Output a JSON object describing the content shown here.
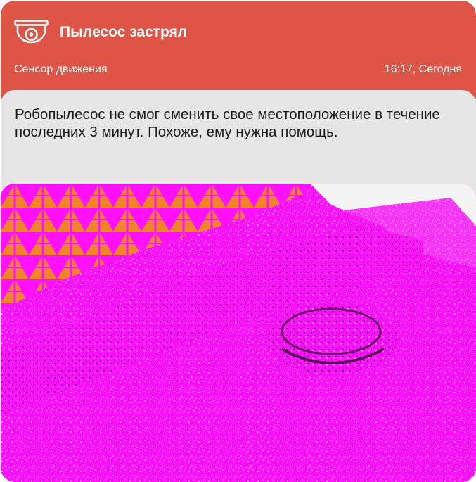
{
  "notification": {
    "title": "Пылесос застрял",
    "sensor": "Сенсор движения",
    "time": "16:17, Сегодня",
    "message": "Робопылесос не смог сменить свое местоположение в течение последних 3 минут. Похоже, ему нужна помощь.",
    "icon": "security-camera-icon"
  },
  "colors": {
    "header_bg": "#de5446",
    "body_bg": "#e6e6e6",
    "text_primary": "#1a1a1a",
    "header_text": "#ffffff"
  },
  "snapshot": {
    "description_visible": false
  }
}
